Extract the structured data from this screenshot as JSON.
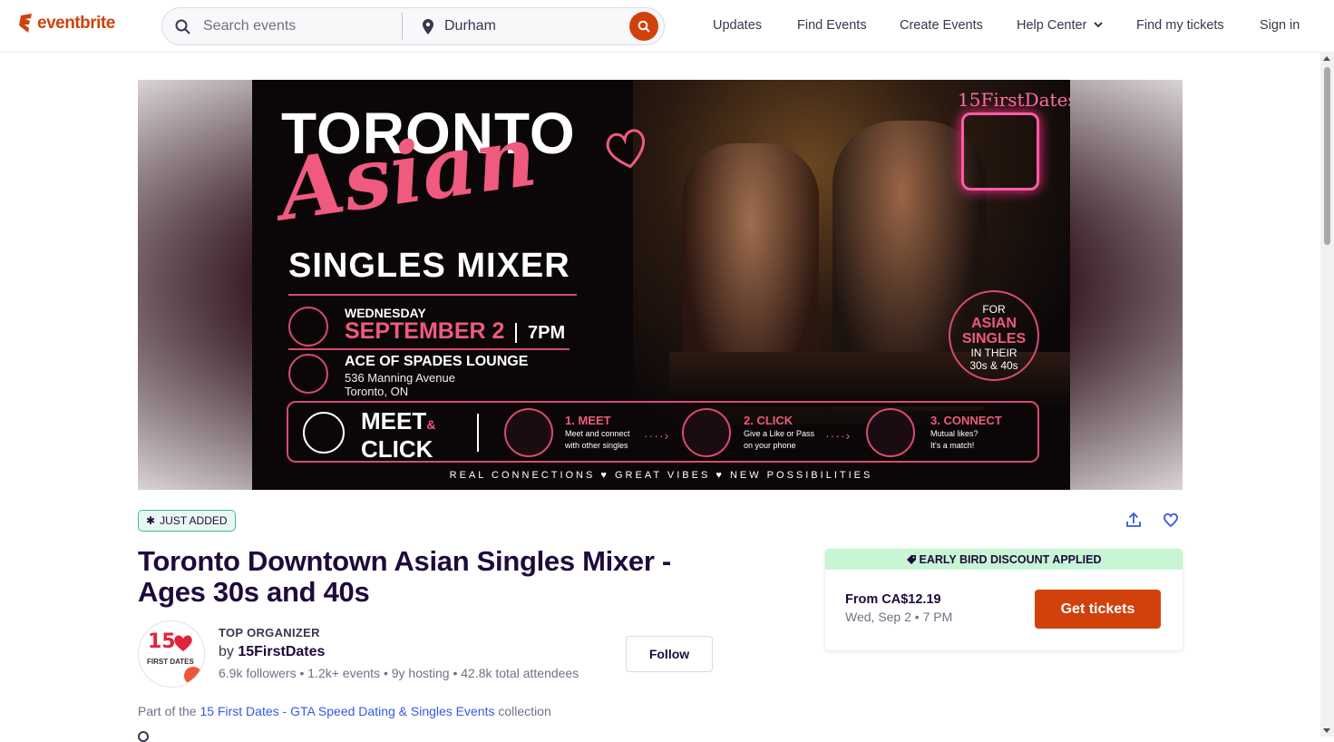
{
  "header": {
    "logo_text": "eventbrite",
    "search_placeholder": "Search events",
    "location_value": "Durham",
    "nav": [
      "Updates",
      "Find Events",
      "Create Events",
      "Help Center",
      "Find my tickets",
      "Sign in"
    ],
    "brand_color": "#d1410c"
  },
  "banner": {
    "title_line1": "TORONTO",
    "title_line2": "Asian",
    "title_line3": "SINGLES MIXER",
    "day": "WEDNESDAY",
    "date": "SEPTEMBER 2",
    "time": "7PM",
    "venue": "ACE OF SPADES LOUNGE",
    "address1": "536 Manning Avenue",
    "address2": "Toronto, ON",
    "brand": "15FirstDates",
    "badge_top": "FOR",
    "badge_mid1": "ASIAN",
    "badge_mid2": "SINGLES",
    "badge_bot1": "IN THEIR",
    "badge_bot2": "30s & 40s",
    "meet_line1": "MEET",
    "meet_amp": "&",
    "meet_line2": "CLICK",
    "steps": [
      {
        "title": "1. MEET",
        "sub1": "Meet and connect",
        "sub2": "with other singles"
      },
      {
        "title": "2. CLICK",
        "sub1": "Give a Like or Pass",
        "sub2": "on your phone"
      },
      {
        "title": "3. CONNECT",
        "sub1": "Mutual likes?",
        "sub2": "It's a match!"
      }
    ],
    "tagline": "REAL CONNECTIONS ♥ GREAT VIBES ♥ NEW POSSIBILITIES"
  },
  "event": {
    "badge": "JUST ADDED",
    "title": "Toronto Downtown Asian Singles Mixer - Ages 30s and 40s",
    "organizer_tag": "TOP ORGANIZER",
    "by_prefix": "by",
    "organizer": "15FirstDates",
    "avatar_line1": "15",
    "avatar_line2": "FIRST DATES",
    "stats": "6.9k followers • 1.2k+ events • 9y hosting • 42.8k total attendees",
    "follow_label": "Follow",
    "collection_prefix": "Part of the",
    "collection_link": "15 First Dates - GTA Speed Dating & Singles Events",
    "collection_suffix": "collection"
  },
  "tickets": {
    "discount": "EARLY BIRD DISCOUNT APPLIED",
    "price": "From CA$12.19",
    "date": "Wed, Sep 2 • 7 PM",
    "button": "Get tickets"
  }
}
